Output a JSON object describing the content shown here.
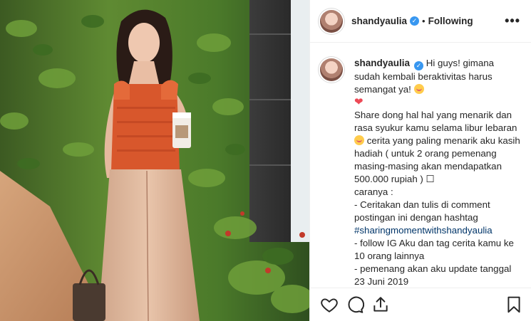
{
  "post": {
    "username": "shandyaulia",
    "verified": true,
    "separator": "•",
    "follow_status": "Following",
    "more_options": "•••"
  },
  "caption": {
    "username": "shandyaulia",
    "intro": "Hi guys! gimana sudah kembali beraktivitas harus semangat ya!",
    "para1a": "Share dong hal hal yang menarik dan rasa syukur kamu selama libur lebaran",
    "para1b": "cerita yang paling menarik aku kasih hadiah ( untuk 2 orang pemenang masing-masing akan mendapatkan 500.000 rupiah ) ☐",
    "caranya": "caranya :",
    "step1": "- Ceritakan dan tulis di comment postingan ini dengan hashtag",
    "hashtag": "#sharingmomentwithshandyaulia",
    "step2": "- follow IG Aku dan tag cerita kamu ke 10 orang lainnya",
    "step3": "- pemenang akan aku update tanggal 23 Juni 2019",
    "heart": "❤"
  },
  "icons": {
    "like": "heart-outline-icon",
    "comment": "comment-bubble-icon",
    "share": "share-icon",
    "save": "bookmark-icon"
  },
  "colors": {
    "verified": "#3897f0",
    "heart": "#ed4956",
    "hashtag": "#003569",
    "border": "#efefef"
  }
}
